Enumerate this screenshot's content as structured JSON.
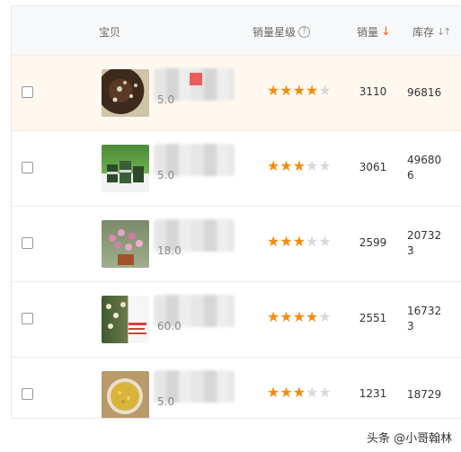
{
  "header": {
    "product": "宝贝",
    "rating": "销量星级",
    "help": "?",
    "sales": "销量",
    "sales_sort": "↓",
    "stock": "库存",
    "stock_sort": "↓↑"
  },
  "rows": [
    {
      "price": "5.0",
      "stars": 4,
      "sales": "3110",
      "stock_line1": "96816",
      "stock_line2": "",
      "thumb": "soil"
    },
    {
      "price": "5.0",
      "stars": 3,
      "sales": "3061",
      "stock_line1": "49680",
      "stock_line2": "6",
      "thumb": "pots"
    },
    {
      "price": "18.0",
      "stars": 3,
      "sales": "2599",
      "stock_line1": "20732",
      "stock_line2": "3",
      "thumb": "flowers"
    },
    {
      "price": "60.0",
      "stars": 4,
      "sales": "2551",
      "stock_line1": "16732",
      "stock_line2": "3",
      "thumb": "roses"
    },
    {
      "price": "5.0",
      "stars": 3,
      "sales": "1231",
      "stock_line1": "18729",
      "stock_line2": "",
      "thumb": "grain"
    }
  ],
  "watermark": "头条 @小哥翰林",
  "colors": {
    "star_on": "#f28c0d",
    "star_off": "#d9d9d9",
    "sort_active": "#ff5a1f",
    "row_highlight": "#fff8f1"
  }
}
